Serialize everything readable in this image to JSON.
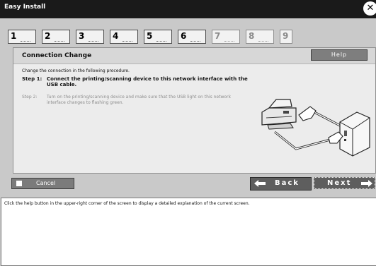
{
  "window": {
    "title": "Easy Install"
  },
  "steps": [
    {
      "num": "1",
      "active": true
    },
    {
      "num": "2",
      "active": true
    },
    {
      "num": "3",
      "active": true
    },
    {
      "num": "4",
      "active": true
    },
    {
      "num": "5",
      "active": true
    },
    {
      "num": "6",
      "active": true
    },
    {
      "num": "7",
      "active": false
    },
    {
      "num": "8",
      "active": false
    },
    {
      "num": "9",
      "active": false
    }
  ],
  "panel": {
    "title": "Connection Change",
    "help_label": "Help",
    "intro": "Change the connection in the following procedure.",
    "step1_label": "Step 1:",
    "step1_text": "Connect the printing/scanning device to this network interface with the USB cable.",
    "step2_label": "Step 2:",
    "step2_text": "Turn on the printing/scanning device and make sure that the USB light on this network interface changes to flashing green."
  },
  "buttons": {
    "cancel": "Cancel",
    "back": "Back",
    "next": "Next"
  },
  "info": {
    "text": "Click the help button in the upper-right corner of the screen to display a detailed explanation of the current screen."
  },
  "colors": {
    "titlebar": "#1a1a1a",
    "background": "#c9c9c9",
    "panel": "#ececec",
    "button": "#5e5e5e"
  }
}
